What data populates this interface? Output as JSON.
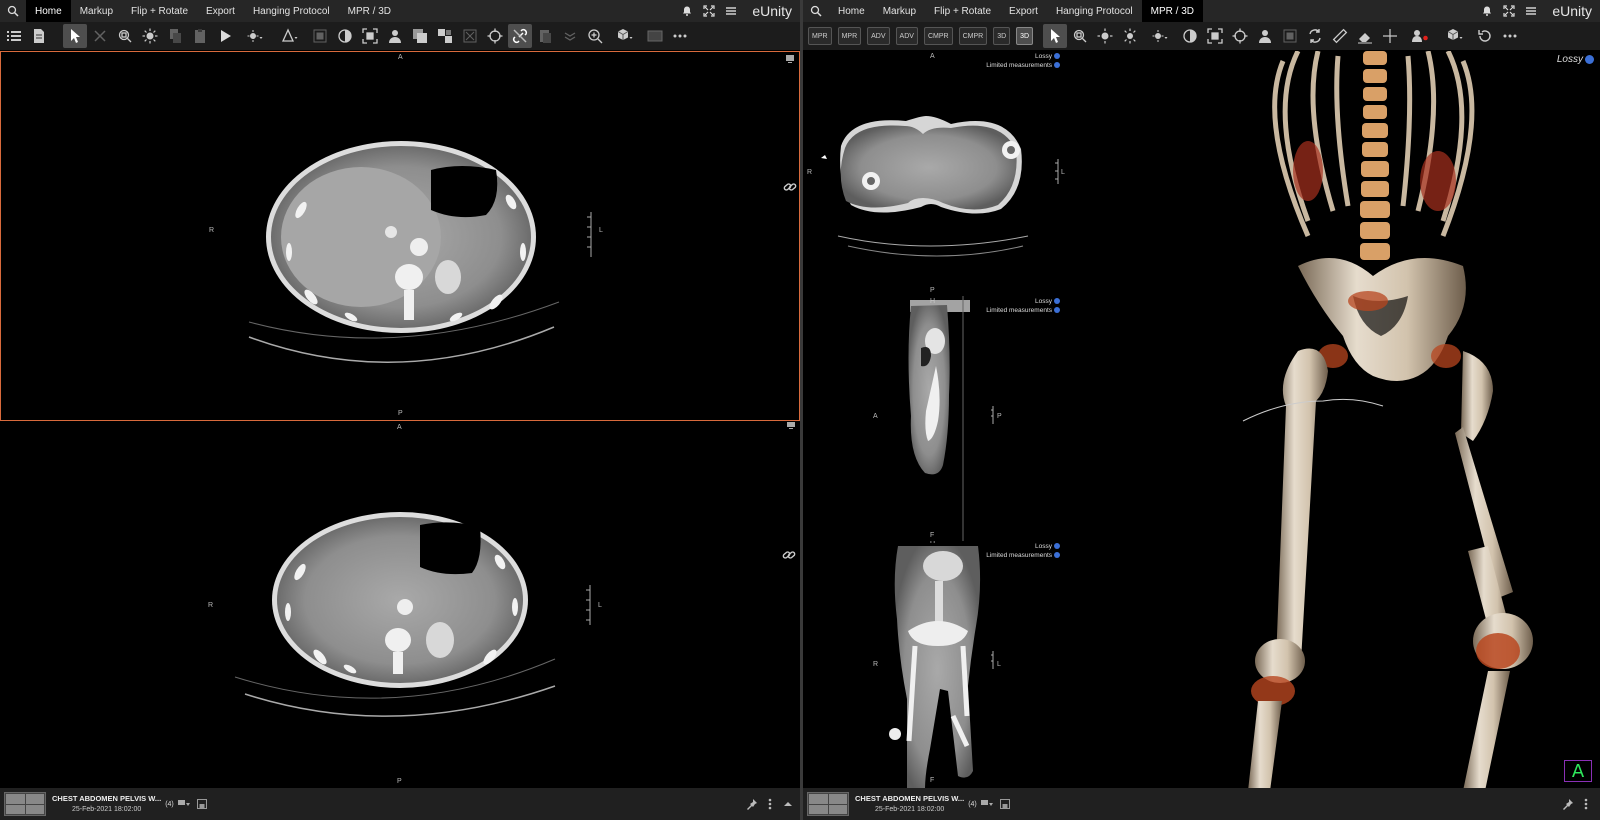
{
  "app": {
    "brand": "eUnity"
  },
  "left": {
    "tabs": [
      {
        "label": "Home",
        "active": true
      },
      {
        "label": "Markup",
        "active": false
      },
      {
        "label": "Flip + Rotate",
        "active": false
      },
      {
        "label": "Export",
        "active": false
      },
      {
        "label": "Hanging Protocol",
        "active": false
      },
      {
        "label": "MPR / 3D",
        "active": false
      }
    ],
    "views": {
      "top": {
        "orient": {
          "top": "A",
          "bottom": "P",
          "left": "R",
          "right": "L"
        },
        "active": true
      },
      "bottom": {
        "orient": {
          "top": "A",
          "bottom": "P",
          "left": "R",
          "right": "L"
        },
        "active": false
      }
    },
    "status": {
      "study_title": "CHEST ABDOMEN PELVIS W...",
      "study_date": "25-Feb-2021 18:02:00",
      "series_count": "(4)"
    }
  },
  "right": {
    "tabs": [
      {
        "label": "Home",
        "active": false
      },
      {
        "label": "Markup",
        "active": false
      },
      {
        "label": "Flip + Rotate",
        "active": false
      },
      {
        "label": "Export",
        "active": false
      },
      {
        "label": "Hanging Protocol",
        "active": false
      },
      {
        "label": "MPR / 3D",
        "active": true
      }
    ],
    "mpr_buttons": [
      {
        "label": "MPR",
        "selected": false
      },
      {
        "label": "MPR",
        "selected": false
      },
      {
        "label": "ADV",
        "selected": false
      },
      {
        "label": "ADV",
        "selected": false
      },
      {
        "label": "CMPR",
        "selected": false
      },
      {
        "label": "CMPR",
        "selected": false
      },
      {
        "label": "3D",
        "selected": false
      },
      {
        "label": "3D",
        "selected": true
      }
    ],
    "views": {
      "axial": {
        "orient": {
          "top": "A",
          "bottom": "P",
          "left": "R",
          "right": "L"
        },
        "lossy": "Lossy",
        "limited": "Limited measurements"
      },
      "sagittal": {
        "orient": {
          "top": "H",
          "bottom": "F",
          "left": "A",
          "right": "P"
        },
        "lossy": "Lossy",
        "limited": "Limited measurements"
      },
      "coronal": {
        "orient": {
          "top": "H",
          "bottom": "F",
          "left": "R",
          "right": "L"
        },
        "lossy": "Lossy",
        "limited": "Limited measurements"
      },
      "volume": {
        "lossy": "Lossy",
        "badge": "A"
      }
    },
    "status": {
      "study_title": "CHEST ABDOMEN PELVIS W...",
      "study_date": "25-Feb-2021 18:02:00",
      "series_count": "(4)"
    }
  },
  "colors": {
    "active_border": "#d86a3c",
    "menubar_bg": "#262626",
    "toolbar_bg": "#1c1c1c",
    "info_blue": "#3b6fd6",
    "rec_red": "#e0211b"
  }
}
